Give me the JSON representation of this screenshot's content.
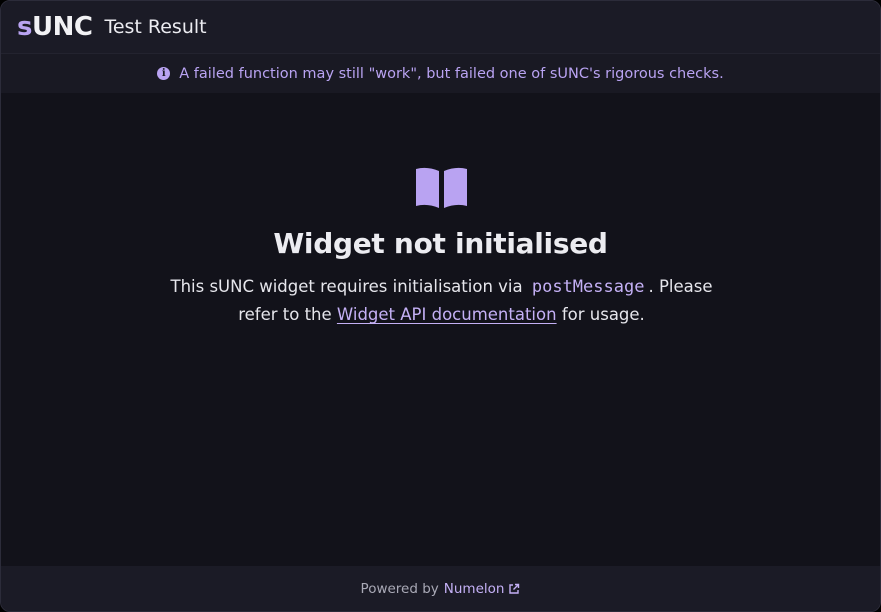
{
  "header": {
    "brand_prefix": "s",
    "brand_suffix": "UNC",
    "title": "Test Result"
  },
  "banner": {
    "icon": "info-icon",
    "text": "A failed function may still \"work\", but failed one of sUNC's rigorous checks."
  },
  "main": {
    "icon": "book-open-icon",
    "title": "Widget not initialised",
    "desc_part1": "This sUNC widget requires initialisation via",
    "code": "postMessage",
    "desc_part2": ". Please refer to the",
    "link_label": "Widget API documentation",
    "desc_part3": "for usage."
  },
  "footer": {
    "powered_by": "Powered by",
    "link_label": "Numelon",
    "link_icon": "external-link-icon"
  },
  "colors": {
    "accent": "#b9a3f2",
    "background": "#12121a",
    "panel": "#1b1b26",
    "text": "#ececf1"
  }
}
